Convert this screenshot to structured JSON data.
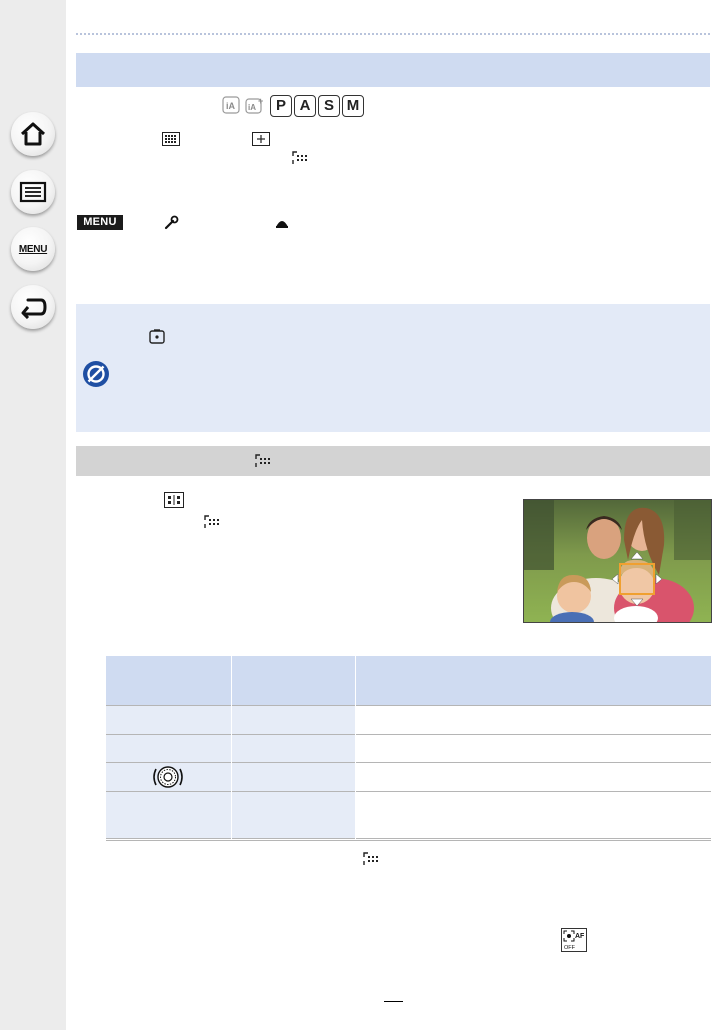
{
  "sidebar": {
    "items": [
      {
        "icon": "home-icon",
        "label": ""
      },
      {
        "icon": "contents-list-icon",
        "label": ""
      },
      {
        "icon": "menu-list-icon",
        "label": "MENU"
      },
      {
        "icon": "back-icon",
        "label": ""
      }
    ]
  },
  "modes": {
    "icons": [
      "intelligent-auto-icon",
      "intelligent-auto-plus-icon"
    ],
    "buttons": [
      "P",
      "A",
      "S",
      "M"
    ]
  },
  "menu_tag": "MENU",
  "colors": {
    "header_bar": "#cfdbf1",
    "note_box": "#e3eaf7",
    "section_bar_gray": "#d3d3d3",
    "table_header": "#cfdbf1",
    "table_row": "#e6ecf7",
    "table_border": "#b5b5b5",
    "sidebar": "#ececec"
  },
  "table": {
    "columns": 3,
    "rows": 5,
    "dial_icon": "rear-dial-icon"
  },
  "preview_image": {
    "description_icon": "family-photo-with-af-frame",
    "af_frame_color": "#f0a030"
  },
  "face_detect_off_icon": "face-detect-af-off-icon"
}
